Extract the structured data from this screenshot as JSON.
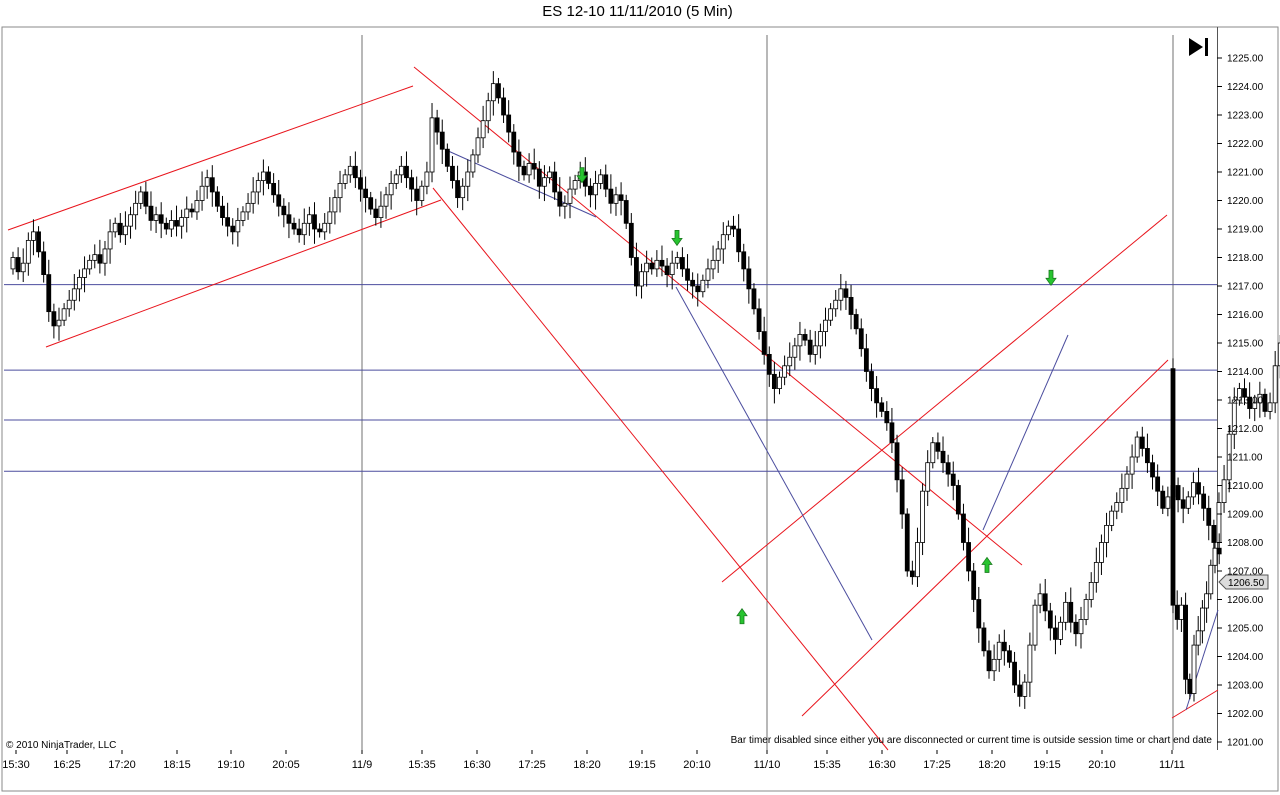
{
  "title": "ES 12-10  11/11/2010 (5 Min)",
  "copyright": "© 2010 NinjaTrader, LLC",
  "bar_timer_note": "Bar timer disabled since either you are disconnected or current time is outside session time or chart end date",
  "current_price_label": "1206.50",
  "go_to_end_icon": "skip-to-end-icon",
  "colors": {
    "trendline": "#e8141c",
    "blue_line": "#4b4d9e",
    "arrow": "#27c42f",
    "grid": "#707070",
    "candle": "#000000"
  },
  "chart_data": {
    "type": "candlestick",
    "symbol": "ES 12-10",
    "interval": "5 Min",
    "ylim": [
      1201,
      1225
    ],
    "y_ticks": [
      "1201.00",
      "1202.00",
      "1203.00",
      "1204.00",
      "1205.00",
      "1206.00",
      "1207.00",
      "1208.00",
      "1209.00",
      "1210.00",
      "1211.00",
      "1212.00",
      "1213.00",
      "1214.00",
      "1215.00",
      "1216.00",
      "1217.00",
      "1218.00",
      "1219.00",
      "1220.00",
      "1221.00",
      "1222.00",
      "1223.00",
      "1224.00",
      "1225.00"
    ],
    "x_ticks": [
      "15:30",
      "16:25",
      "17:20",
      "18:15",
      "19:10",
      "20:05",
      "11/9",
      "15:35",
      "16:30",
      "17:25",
      "18:20",
      "19:15",
      "20:10",
      "11/10",
      "15:35",
      "16:30",
      "17:25",
      "18:20",
      "19:15",
      "20:10",
      "11/11"
    ],
    "session_breaks": [
      "11/9",
      "11/10",
      "11/11"
    ],
    "horizontal_levels": [
      1217.05,
      1214.05,
      1212.3,
      1210.5
    ],
    "current_price": 1206.5,
    "last_close": 1207.75,
    "signals": [
      {
        "direction": "down",
        "price": 1220.8
      },
      {
        "direction": "down",
        "price": 1218.6
      },
      {
        "direction": "up",
        "price": 1205.5
      },
      {
        "direction": "up",
        "price": 1207.3
      },
      {
        "direction": "down",
        "price": 1217.2
      }
    ],
    "closes": [
      1218.0,
      1217.5,
      1217.8,
      1218.6,
      1218.9,
      1218.2,
      1217.4,
      1216.1,
      1215.6,
      1215.8,
      1216.2,
      1216.5,
      1216.9,
      1217.3,
      1217.6,
      1217.9,
      1218.1,
      1217.8,
      1218.3,
      1218.9,
      1219.2,
      1218.8,
      1219.1,
      1219.5,
      1219.9,
      1220.3,
      1219.8,
      1219.3,
      1219.5,
      1219.2,
      1219.0,
      1219.3,
      1219.1,
      1219.4,
      1219.7,
      1219.6,
      1220.0,
      1220.5,
      1220.8,
      1220.3,
      1219.8,
      1219.4,
      1219.1,
      1218.9,
      1219.3,
      1219.6,
      1219.9,
      1220.3,
      1220.7,
      1221.0,
      1220.6,
      1220.2,
      1219.8,
      1219.5,
      1219.2,
      1219.0,
      1218.8,
      1219.2,
      1219.5,
      1219.0,
      1218.9,
      1219.2,
      1219.6,
      1220.1,
      1220.6,
      1220.9,
      1221.2,
      1220.8,
      1220.4,
      1220.1,
      1219.7,
      1219.4,
      1219.8,
      1220.2,
      1220.6,
      1220.9,
      1221.2,
      1220.8,
      1220.4,
      1220.0,
      1220.5,
      1221.0,
      1222.9,
      1222.4,
      1221.8,
      1221.2,
      1220.7,
      1220.1,
      1220.5,
      1221.0,
      1221.6,
      1222.2,
      1222.8,
      1223.5,
      1224.1,
      1223.6,
      1223.0,
      1222.4,
      1221.7,
      1221.2,
      1220.9,
      1221.3,
      1221.1,
      1220.5,
      1220.8,
      1221.0,
      1220.3,
      1219.8,
      1219.9,
      1220.4,
      1220.7,
      1221.0,
      1220.5,
      1220.2,
      1220.6,
      1220.9,
      1220.4,
      1219.9,
      1220.2,
      1220.0,
      1219.2,
      1218.0,
      1217.0,
      1217.5,
      1217.8,
      1217.6,
      1217.9,
      1217.7,
      1217.4,
      1217.8,
      1218.0,
      1217.6,
      1217.2,
      1217.0,
      1216.8,
      1217.2,
      1217.6,
      1217.9,
      1218.3,
      1218.8,
      1219.1,
      1219.0,
      1218.2,
      1217.6,
      1216.9,
      1216.2,
      1215.4,
      1214.6,
      1213.9,
      1213.4,
      1213.8,
      1214.2,
      1214.5,
      1214.9,
      1215.3,
      1215.1,
      1214.6,
      1214.9,
      1215.4,
      1215.8,
      1216.2,
      1216.5,
      1216.9,
      1216.6,
      1216.0,
      1215.5,
      1214.8,
      1214.0,
      1213.4,
      1212.9,
      1212.6,
      1212.2,
      1211.5,
      1210.2,
      1209.0,
      1207.0,
      1206.8,
      1208.0,
      1209.8,
      1210.8,
      1211.5,
      1211.2,
      1210.8,
      1210.4,
      1210.0,
      1209.0,
      1208.0,
      1207.0,
      1206.0,
      1205.0,
      1204.2,
      1203.5,
      1203.9,
      1204.5,
      1204.2,
      1203.8,
      1203.0,
      1202.6,
      1203.1,
      1204.4,
      1205.8,
      1206.2,
      1205.6,
      1205.0,
      1204.6,
      1205.2,
      1205.9,
      1205.2,
      1204.8,
      1205.3,
      1206.0,
      1206.6,
      1207.3,
      1208.0,
      1208.6,
      1209.1,
      1209.4,
      1209.9,
      1210.4,
      1211.0,
      1211.7,
      1211.3,
      1210.8,
      1210.3,
      1209.8,
      1209.2,
      1209.6,
      1210.0,
      1209.5,
      1209.2,
      1209.6,
      1210.1,
      1209.7,
      1209.2,
      1208.6,
      1208.0,
      1209.4,
      1210.2,
      1211.8,
      1213.0,
      1213.4,
      1213.1,
      1212.7,
      1212.9,
      1213.2,
      1212.6,
      1212.9,
      1214.2,
      1215.0,
      1215.8,
      1216.3,
      1215.8,
      1215.3,
      1214.9,
      1215.4,
      1215.9,
      1215.5,
      1215.0,
      1214.6,
      1214.8,
      1215.2,
      1215.5,
      1215.0,
      1214.7,
      1215.3,
      1215.6,
      1215.1,
      1214.4,
      1214.2,
      1214.7,
      1215.2,
      1215.0,
      1214.6,
      1214.9,
      1215.3,
      1215.6,
      1215.9,
      1215.4,
      1214.8,
      1214.2,
      1214.1,
      1205.8,
      1205.3,
      1205.8,
      1203.2,
      1202.7,
      1204.4,
      1204.9,
      1205.7,
      1206.2,
      1207.2,
      1207.8,
      1207.6
    ]
  }
}
